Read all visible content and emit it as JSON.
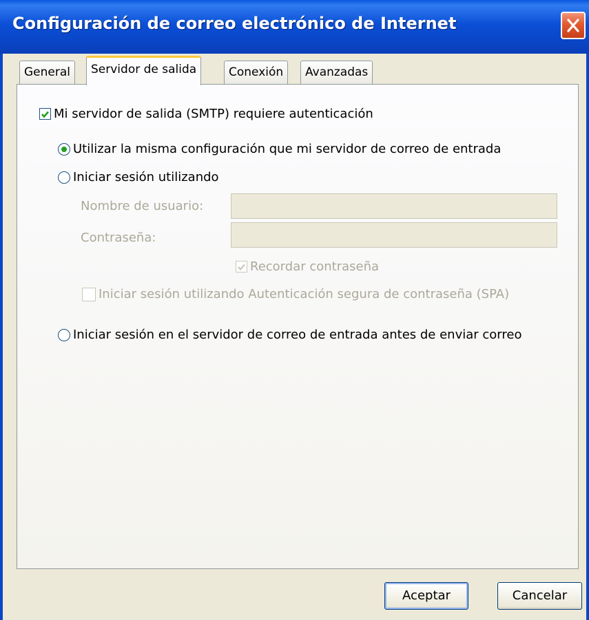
{
  "window": {
    "title": "Configuración de correo electrónico de Internet"
  },
  "tabs": [
    {
      "label": "General",
      "active": false
    },
    {
      "label": "Servidor de salida",
      "active": true
    },
    {
      "label": "Conexión",
      "active": false
    },
    {
      "label": "Avanzadas",
      "active": false
    }
  ],
  "panel": {
    "smtp_auth": {
      "label": "Mi servidor de salida (SMTP) requiere autenticación",
      "checked": true
    },
    "radio_same": {
      "label": "Utilizar la misma configuración que mi servidor de correo de entrada",
      "selected": true
    },
    "radio_login": {
      "label": "Iniciar sesión utilizando",
      "selected": false
    },
    "username": {
      "label": "Nombre de usuario:",
      "value": ""
    },
    "password": {
      "label": "Contraseña:",
      "value": ""
    },
    "remember": {
      "label": "Recordar contraseña",
      "checked": true
    },
    "spa": {
      "label": "Iniciar sesión utilizando Autenticación segura de contraseña (SPA)",
      "checked": false
    },
    "radio_incoming_first": {
      "label": "Iniciar sesión en el servidor de correo de entrada antes de enviar correo",
      "selected": false
    }
  },
  "buttons": {
    "ok": "Aceptar",
    "cancel": "Cancelar"
  },
  "colors": {
    "titlebar": "#0a46c8",
    "close": "#e05a2e",
    "tab_active_accent": "#ffc83c",
    "check_green": "#21a121",
    "disabled_text": "#aca899"
  },
  "icons": {
    "close": "close-icon",
    "check": "checkmark-icon"
  }
}
